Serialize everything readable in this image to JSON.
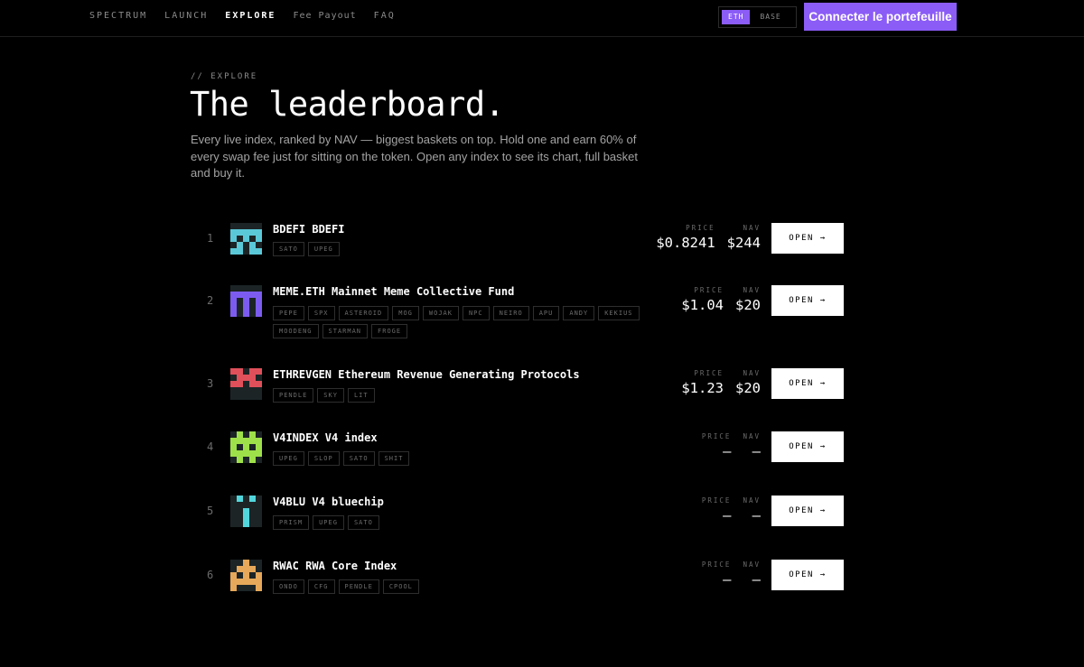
{
  "nav": {
    "links": [
      "SPECTRUM",
      "LAUNCH",
      "EXPLORE",
      "Fee Payout",
      "FAQ"
    ],
    "active": "EXPLORE",
    "chain_options": [
      "ETH",
      "BASE"
    ],
    "chain_selected": "ETH",
    "connect_label": "Connecter le portefeuille"
  },
  "header": {
    "eyebrow": "// EXPLORE",
    "title": "The leaderboard.",
    "description": "Every live index, ranked by NAV — biggest baskets on top. Hold one and earn 60% of every swap fee just for sitting on the token. Open any index to see its chart, full basket and buy it."
  },
  "labels": {
    "price": "PRICE",
    "nav": "NAV",
    "open": "OPEN →"
  },
  "colors": {
    "accent": "#8b5cf6"
  },
  "indexes": [
    {
      "rank": "1",
      "name": "BDEFI BDEFI",
      "tags": [
        "SATO",
        "UPEG"
      ],
      "price": "$0.8241",
      "nav": "$244",
      "color": "#5bc8d8",
      "icon": "bdefi-pixel-avatar-icon"
    },
    {
      "rank": "2",
      "name": "MEME.ETH Mainnet Meme Collective Fund",
      "tags": [
        "PEPE",
        "SPX",
        "ASTEROID",
        "MOG",
        "WOJAK",
        "NPC",
        "NEIRO",
        "APU",
        "ANDY",
        "KEKIUS",
        "MOODENG",
        "STARMAN",
        "FROGE"
      ],
      "price": "$1.04",
      "nav": "$20",
      "color": "#7c5cf0",
      "icon": "meme-eth-pixel-avatar-icon"
    },
    {
      "rank": "3",
      "name": "ETHREVGEN Ethereum Revenue Generating Protocols",
      "tags": [
        "PENDLE",
        "SKY",
        "LIT"
      ],
      "price": "$1.23",
      "nav": "$20",
      "color": "#e0505a",
      "icon": "ethrevgen-pixel-avatar-icon"
    },
    {
      "rank": "4",
      "name": "V4INDEX V4 index",
      "tags": [
        "UPEG",
        "SLOP",
        "SATO",
        "SHIT"
      ],
      "price": "—",
      "nav": "—",
      "color": "#9ee04a",
      "icon": "v4index-pixel-avatar-icon"
    },
    {
      "rank": "5",
      "name": "V4BLU V4 bluechip",
      "tags": [
        "PRISM",
        "UPEG",
        "SATO"
      ],
      "price": "—",
      "nav": "—",
      "color": "#52d6dc",
      "icon": "v4blu-pixel-avatar-icon"
    },
    {
      "rank": "6",
      "name": "RWAC RWA Core Index",
      "tags": [
        "ONDO",
        "CFG",
        "PENDLE",
        "CPOOL"
      ],
      "price": "—",
      "nav": "—",
      "color": "#e6a85a",
      "icon": "rwac-pixel-avatar-icon"
    }
  ]
}
